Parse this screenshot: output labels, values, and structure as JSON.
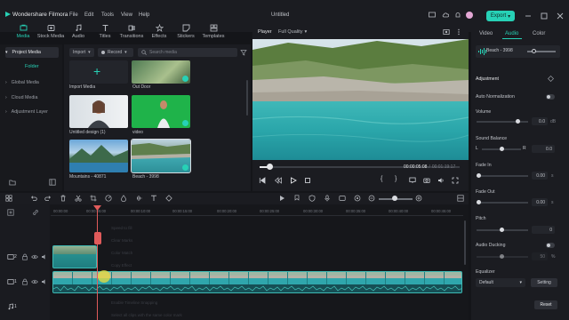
{
  "app": {
    "name": "Wondershare Filmora",
    "project_title": "Untitled"
  },
  "menu": [
    "File",
    "Edit",
    "Tools",
    "View",
    "Help"
  ],
  "export_label": "Export",
  "media_tabs": [
    {
      "label": "Media",
      "icon": "media-icon"
    },
    {
      "label": "Stock Media",
      "icon": "stock-media-icon"
    },
    {
      "label": "Audio",
      "icon": "music-note-icon"
    },
    {
      "label": "Titles",
      "icon": "text-t-icon"
    },
    {
      "label": "Transitions",
      "icon": "transitions-icon"
    },
    {
      "label": "Effects",
      "icon": "effects-icon"
    },
    {
      "label": "Stickers",
      "icon": "stickers-icon"
    },
    {
      "label": "Templates",
      "icon": "templates-icon"
    }
  ],
  "left_nav": {
    "project_media": "Project Media",
    "folder": "Folder",
    "global_media": "Global Media",
    "cloud_media": "Cloud Media",
    "adjustment_layer": "Adjustment Layer"
  },
  "media_toolbar": {
    "import": "Import",
    "record": "Record",
    "search_placeholder": "Search media"
  },
  "media_items": [
    {
      "label": "Import Media"
    },
    {
      "label": "Out Door"
    },
    {
      "label": "Untitled design (1)"
    },
    {
      "label": "video"
    },
    {
      "label": "Mountains - 40871"
    },
    {
      "label": "Beach - 3998"
    }
  ],
  "player": {
    "tab": "Player",
    "quality": "Full Quality",
    "current_time": "00:00:05:08",
    "total_time": "00:01:19:17",
    "progress": 0.05
  },
  "right_panel": {
    "tabs": [
      "Video",
      "Audio",
      "Color"
    ],
    "clip_name": "Beach - 3998",
    "adjustment": "Adjustment",
    "auto_normalization": "Auto Normalization",
    "volume": "Volume",
    "volume_value": "0.0",
    "volume_unit": "dB",
    "sound_balance": "Sound Balance",
    "balance_left": "L",
    "balance_right": "R",
    "balance_value": "0.0",
    "fade_in": "Fade In",
    "fade_in_value": "0.00",
    "fade_in_unit": "s",
    "fade_out": "Fade Out",
    "fade_out_value": "0.00",
    "fade_out_unit": "s",
    "pitch": "Pitch",
    "pitch_value": "0",
    "audio_ducking": "Audio Ducking",
    "ducking_value": "50",
    "ducking_unit": "%",
    "equalizer": "Equalizer",
    "eq_preset": "Default",
    "setting": "Setting",
    "reset": "Reset"
  },
  "timeline": {
    "ticks": [
      "00:00:00",
      "00:00:05:00",
      "00:00:10:00",
      "00:00:15:00",
      "00:00:20:00",
      "00:00:25:00",
      "00:00:30:00",
      "00:00:35:00",
      "00:00:40:00",
      "00:00:45:00"
    ],
    "ghost_menu": [
      "Speed to fill",
      "Clear Marks",
      "Color Match",
      "Copy Effect",
      "Paste Effect",
      "Delete Effect",
      "Enable Timeline Snapping",
      "Select all clips with the same color mark"
    ],
    "track_labels": [
      "2",
      "1",
      "1"
    ]
  },
  "colors": {
    "accent": "#27d1b6",
    "playhead": "#e05b5b",
    "panel": "#1b1c21",
    "background": "#141519"
  }
}
